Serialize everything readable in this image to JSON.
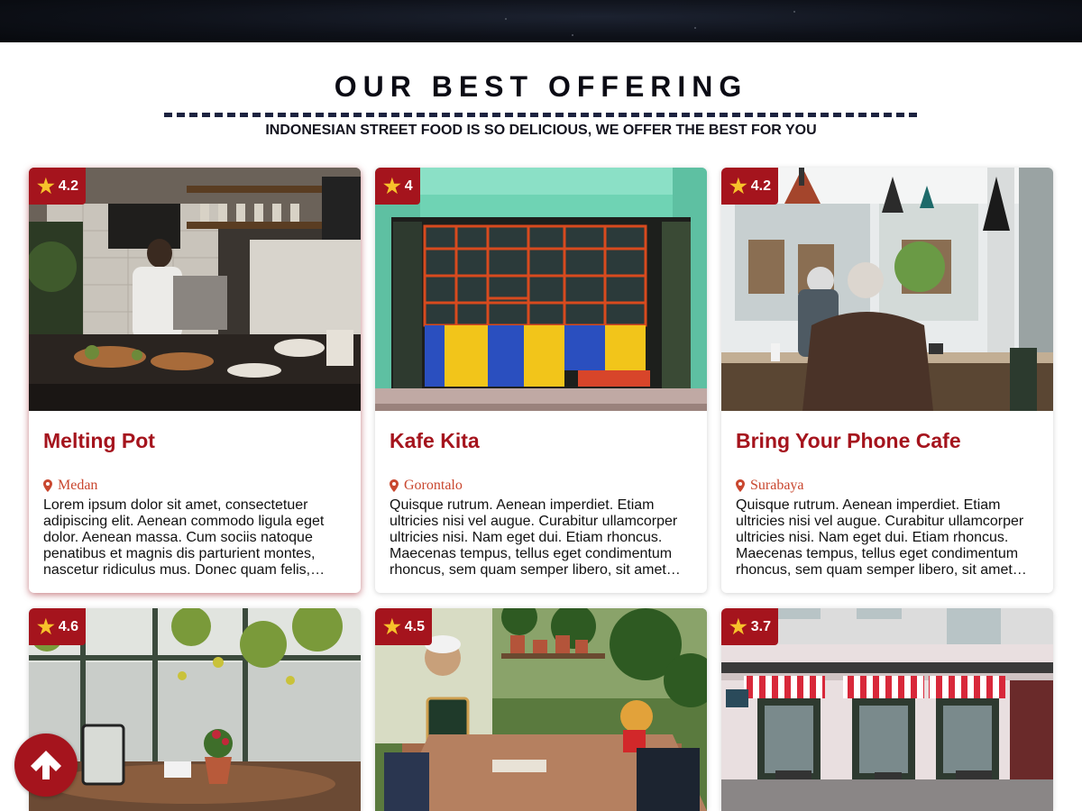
{
  "section": {
    "title": "OUR BEST OFFERING",
    "subtitle": "INDONESIAN STREET FOOD IS SO DELICIOUS, WE OFFER THE BEST FOR YOU"
  },
  "colors": {
    "accent": "#a5141d",
    "star": "#f7c22b",
    "location": "#c9472f",
    "rule": "#1d2340"
  },
  "cards": [
    {
      "rating": "4.2",
      "name": "Melting Pot",
      "location": "Medan",
      "description": "Lorem ipsum dolor sit amet, consectetuer adipiscing elit. Aenean commodo ligula eget dolor. Aenean massa. Cum sociis natoque penatibus et magnis dis parturient montes, nascetur ridiculus mus. Donec quam felis, ultricies nec, pellentesque eu, pretium quis, sem."
    },
    {
      "rating": "4",
      "name": "Kafe Kita",
      "location": "Gorontalo",
      "description": "Quisque rutrum. Aenean imperdiet. Etiam ultricies nisi vel augue. Curabitur ullamcorper ultricies nisi. Nam eget dui. Etiam rhoncus. Maecenas tempus, tellus eget condimentum rhoncus, sem quam semper libero, sit amet adipiscing sem neque sed ipsum."
    },
    {
      "rating": "4.2",
      "name": "Bring Your Phone Cafe",
      "location": "Surabaya",
      "description": "Quisque rutrum. Aenean imperdiet. Etiam ultricies nisi vel augue. Curabitur ullamcorper ultricies nisi. Nam eget dui. Etiam rhoncus. Maecenas tempus, tellus eget condimentum rhoncus, sem quam semper libero, sit amet adipiscing sem neque sed ipsum."
    },
    {
      "rating": "4.6"
    },
    {
      "rating": "4.5"
    },
    {
      "rating": "3.7"
    }
  ],
  "icons": {
    "rating": "star-icon",
    "location": "map-pin-icon",
    "scroll": "arrow-up-icon"
  }
}
